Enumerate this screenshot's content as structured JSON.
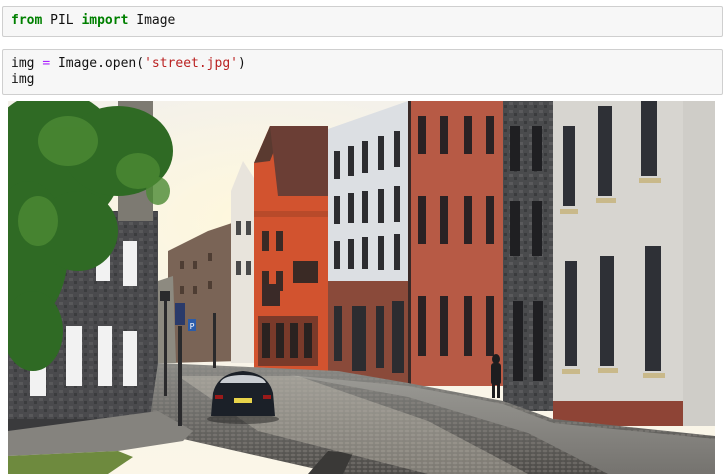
{
  "cells": [
    {
      "tokens": [
        {
          "t": "from",
          "c": "kw"
        },
        {
          "t": " PIL ",
          "c": ""
        },
        {
          "t": "import",
          "c": "kw"
        },
        {
          "t": " Image",
          "c": ""
        }
      ]
    },
    {
      "line1": [
        {
          "t": "img ",
          "c": ""
        },
        {
          "t": "=",
          "c": "op"
        },
        {
          "t": " Image.open(",
          "c": ""
        },
        {
          "t": "'street.jpg'",
          "c": "str"
        },
        {
          "t": ")",
          "c": ""
        }
      ],
      "line2": "img"
    }
  ],
  "output": {
    "image_description_icon": "street-photo",
    "sign_text": "P"
  },
  "colors": {
    "keyword": "#008000",
    "operator": "#aa22ff",
    "string": "#ba2121",
    "cell_bg": "#f7f7f7"
  }
}
